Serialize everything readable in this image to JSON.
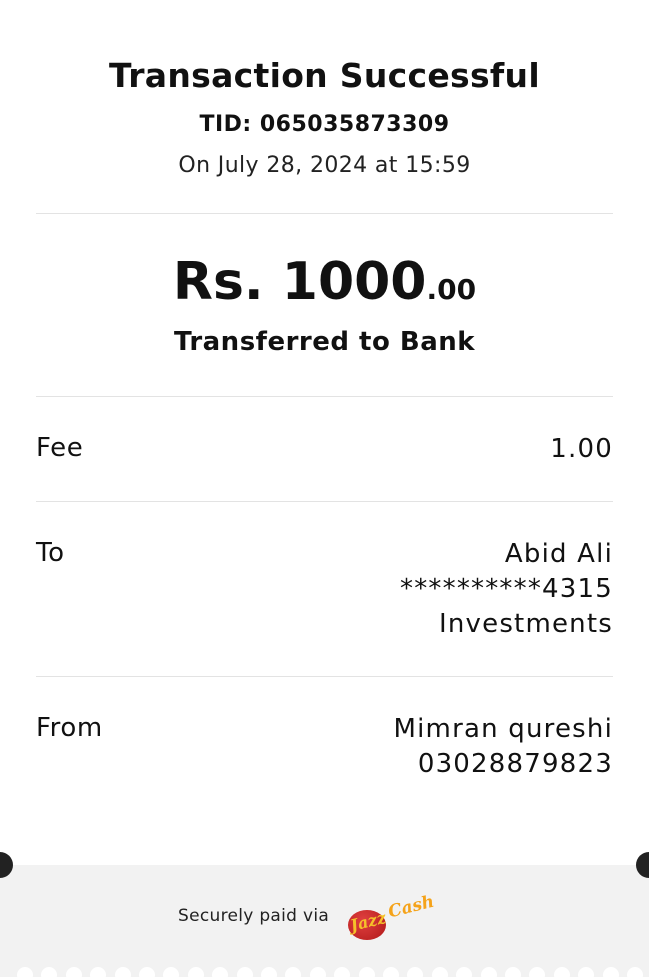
{
  "header": {
    "title": "Transaction Successful",
    "tid": "TID: 065035873309",
    "date": "On July 28, 2024 at 15:59"
  },
  "amount": {
    "main": "Rs. 1000",
    "decimal": ".00",
    "label": "Transferred to Bank"
  },
  "rows": {
    "fee": {
      "label": "Fee",
      "value": "1.00"
    },
    "to": {
      "label": "To",
      "line1": "Abid Ali",
      "line2": "**********4315",
      "line3": "Investments"
    },
    "from": {
      "label": "From",
      "line1": "Mimran qureshi",
      "line2": "03028879823"
    }
  },
  "footer": {
    "secure_text": "Securely paid via",
    "logo_text_1": "Jazz",
    "logo_text_2": "Cash",
    "logo_icon": "jazzcash-logo"
  },
  "colors": {
    "logo_red": "#c0201f",
    "logo_yellow": "#f5c12a",
    "footer_bg": "#f2f2f2"
  }
}
